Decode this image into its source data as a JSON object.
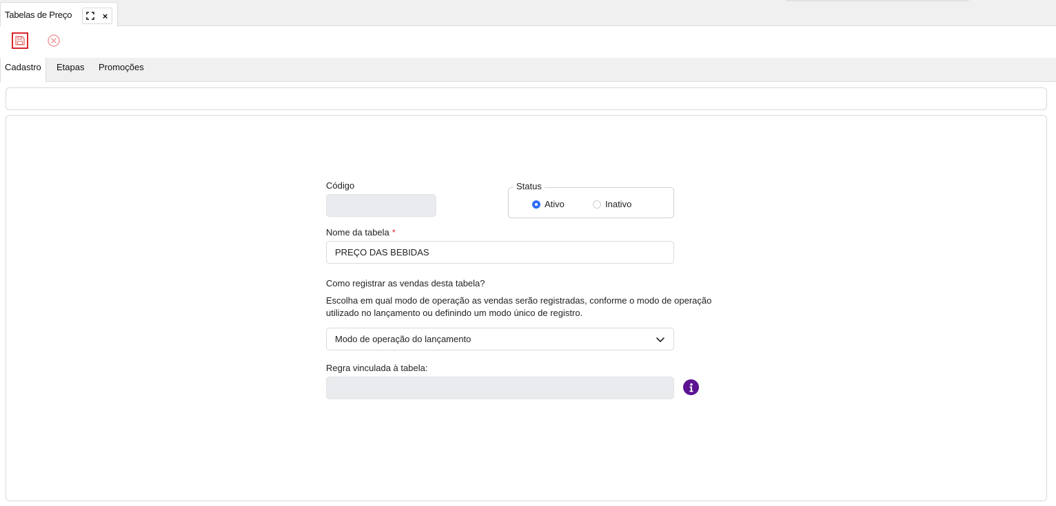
{
  "window_tab": {
    "title": "Tabelas de Preço",
    "expand_icon": "expand-icon",
    "close_label": "×"
  },
  "toolbar": {
    "save_icon": "floppy-disk-icon",
    "cancel_icon": "circle-x-icon",
    "save_border_color": "#d9262c",
    "cancel_color": "#f29a9a"
  },
  "tabs": [
    {
      "label": "Cadastro",
      "active": true
    },
    {
      "label": "Etapas",
      "active": false
    },
    {
      "label": "Promoções",
      "active": false
    }
  ],
  "form": {
    "codigo": {
      "label": "Código",
      "value": ""
    },
    "status": {
      "legend": "Status",
      "options": [
        {
          "label": "Ativo",
          "checked": true
        },
        {
          "label": "Inativo",
          "checked": false
        }
      ]
    },
    "nome": {
      "label": "Nome da tabela",
      "required_mark": "*",
      "value": "PREÇO DAS BEBIDAS"
    },
    "question": "Como registrar as vendas desta tabela?",
    "description_line1": "Escolha em qual modo de operação as vendas serão registradas, conforme o modo de operação",
    "description_line2": "utilizado no lançamento ou definindo um modo único de registro.",
    "modo_select": {
      "value": "Modo de operação do lançamento"
    },
    "regra": {
      "label": "Regra vinculada à tabela:",
      "value": ""
    },
    "info_icon_color": "#5b1391"
  }
}
